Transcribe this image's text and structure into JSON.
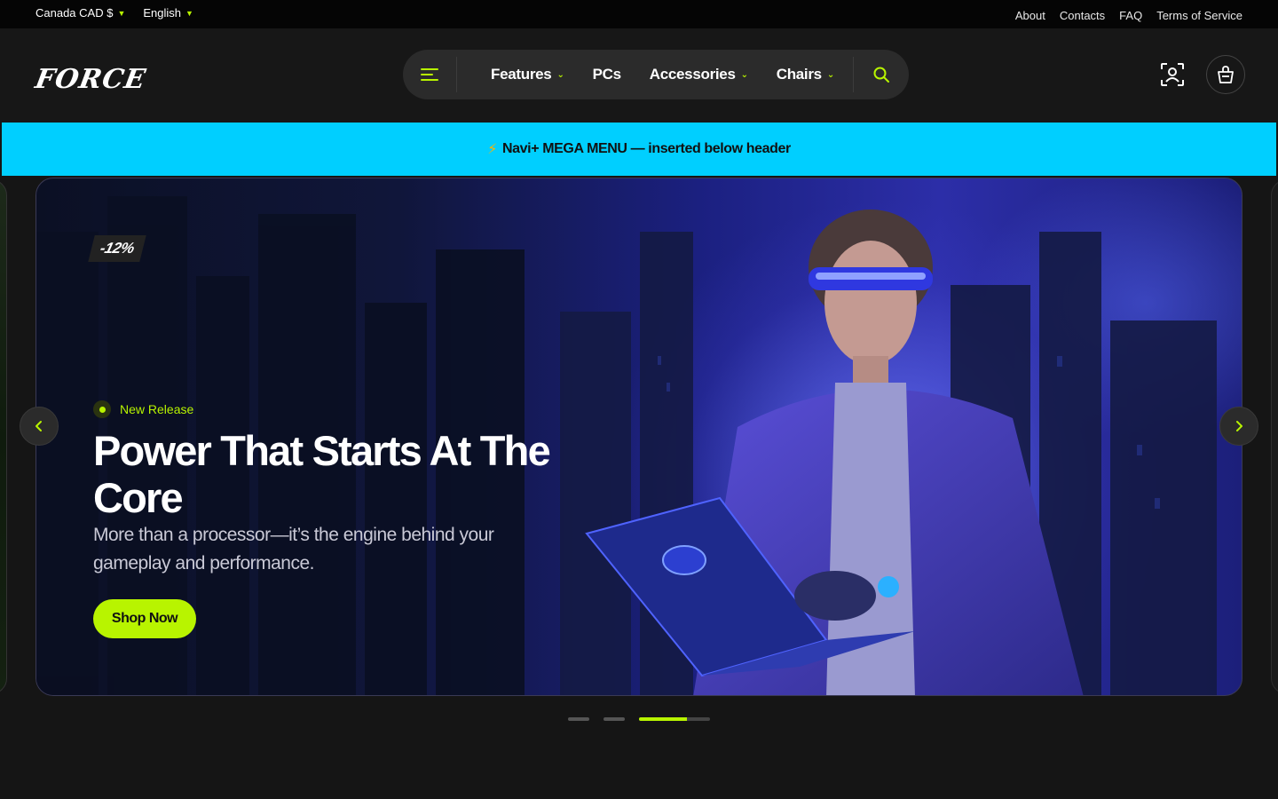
{
  "topbar": {
    "currency": "Canada CAD $",
    "language": "English",
    "links": [
      "About",
      "Contacts",
      "FAQ",
      "Terms of Service"
    ]
  },
  "header": {
    "logo": "FORCE",
    "nav": [
      {
        "label": "Features",
        "has_dropdown": true
      },
      {
        "label": "PCs",
        "has_dropdown": false
      },
      {
        "label": "Accessories",
        "has_dropdown": true
      },
      {
        "label": "Chairs",
        "has_dropdown": true
      }
    ],
    "icons": [
      "menu-icon",
      "search-icon",
      "user-icon",
      "cart-icon"
    ]
  },
  "mega_banner": {
    "bolt": "⚡",
    "text": "Navi+ MEGA MENU — inserted below header"
  },
  "hero": {
    "discount": "-12%",
    "tag": "New Release",
    "title": "Power That Starts At The Core",
    "description": "More than a processor—it’s the engine behind your gameplay and performance.",
    "cta": "Shop Now",
    "slides_total": 3,
    "active_slide": 3,
    "active_progress": 0.68
  },
  "colors": {
    "accent": "#b8f400",
    "banner": "#00cfff",
    "background": "#151515"
  }
}
